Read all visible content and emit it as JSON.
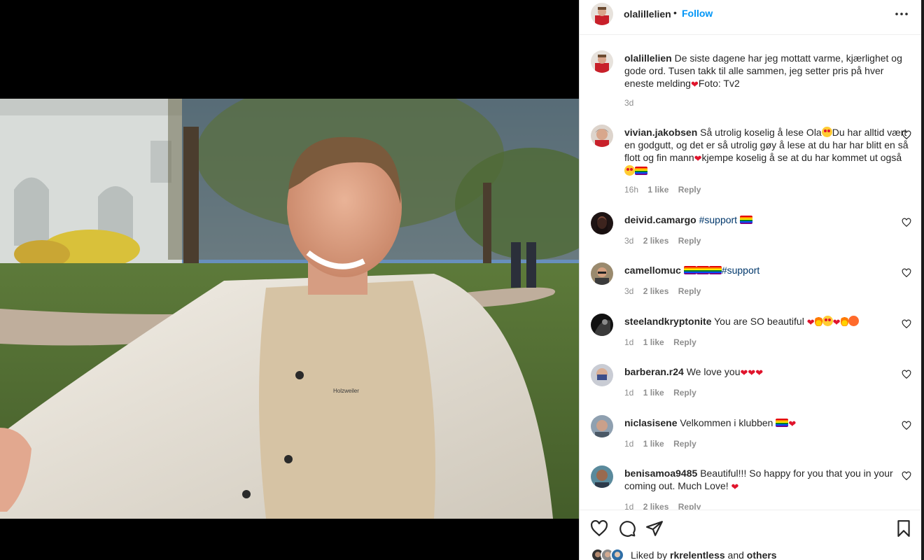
{
  "post": {
    "username": "olalillelien",
    "dot": "•",
    "follow_label": "Follow",
    "caption_user": "olalillelien",
    "caption": "De siste dagene har jeg mottatt varme, kjærlighet og gode ord. Tusen takk til alle sammen, jeg setter pris på hver eneste melding",
    "caption_credit": "Foto: Tv2",
    "caption_time": "3d",
    "photo_print": "Holzweiler"
  },
  "comments": [
    {
      "user": "vivian.jakobsen",
      "text_a": "Så utrolig koselig å lese Ola",
      "text_b": "Du har alltid vært en godgutt, og det er så utrolig gøy å lese at du har har blitt en så flott og fin mann",
      "text_c": "kjempe koselig å se at du har kommet ut også",
      "time": "16h",
      "likes": "1 like",
      "reply": "Reply"
    },
    {
      "user": "deivid.camargo",
      "tag": "#support",
      "time": "3d",
      "likes": "2 likes",
      "reply": "Reply"
    },
    {
      "user": "camellomuc",
      "tag": "#support",
      "time": "3d",
      "likes": "2 likes",
      "reply": "Reply"
    },
    {
      "user": "steelandkryptonite",
      "text": "You are SO beautiful",
      "time": "1d",
      "likes": "1 like",
      "reply": "Reply"
    },
    {
      "user": "barberan.r24",
      "text": "We love you",
      "time": "1d",
      "likes": "1 like",
      "reply": "Reply"
    },
    {
      "user": "niclasisene",
      "text": "Velkommen i klubben",
      "time": "1d",
      "likes": "1 like",
      "reply": "Reply"
    },
    {
      "user": "benisamoa9485",
      "text": "Beautiful!!! So happy for you that you in your coming out. Much Love!",
      "time": "1d",
      "likes": "2 likes",
      "reply": "Reply"
    }
  ],
  "footer": {
    "liked_prefix": "Liked by",
    "liked_user": "rkrelentless",
    "liked_and": "and",
    "liked_others": "others"
  },
  "icons": {
    "more": "more-horizontal-icon",
    "like": "heart-icon",
    "comment": "comment-icon",
    "share": "send-icon",
    "save": "bookmark-icon"
  },
  "colors": {
    "link_blue": "#0095f6",
    "hashtag": "#00376b",
    "muted": "#8e8e8e",
    "heart_red": "#e0142c"
  }
}
